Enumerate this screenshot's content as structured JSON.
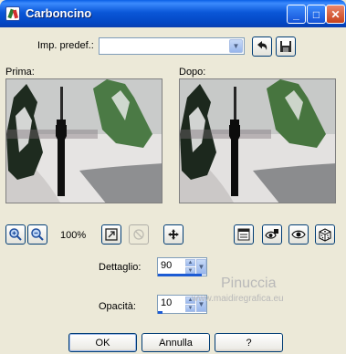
{
  "window": {
    "title": "Carboncino",
    "minimize_label": "_",
    "maximize_label": "□",
    "close_label": "✕"
  },
  "preset": {
    "label": "Imp. predef.:",
    "value": ""
  },
  "previews": {
    "before_label": "Prima:",
    "after_label": "Dopo:"
  },
  "zoom": {
    "level": "100%"
  },
  "controls": {
    "detail_label": "Dettaglio:",
    "detail_value": "90",
    "opacity_label": "Opacità:",
    "opacity_value": "10"
  },
  "buttons": {
    "ok": "OK",
    "cancel": "Annulla",
    "help": "?"
  },
  "watermark": {
    "name": "Pinuccia",
    "site": "www.maidiregrafica.eu"
  },
  "colors": {
    "titlebar": "#0A57D8",
    "dialog_bg": "#ECE9D8",
    "accent": "#1C5BD4"
  }
}
